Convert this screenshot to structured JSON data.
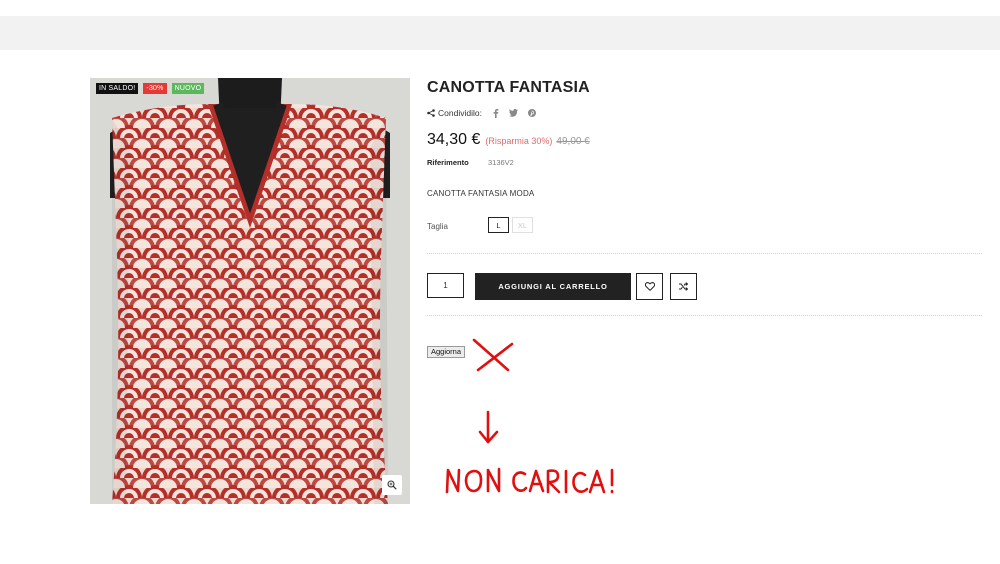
{
  "product": {
    "title": "CANOTTA FANTASIA",
    "share_label": "Condividilo:",
    "price": "34,30 €",
    "savings": "(Risparmia 30%)",
    "old_price": "49,00 €",
    "reference_label": "Riferimento",
    "reference_value": "3136V2",
    "short_description": "CANOTTA FANTASIA MODA",
    "size_label": "Taglia",
    "sizes": [
      "L",
      "XL"
    ],
    "selected_size": "L",
    "quantity": "1",
    "add_to_cart_label": "AGGIUNGI AL CARRELLO"
  },
  "badges": {
    "sale": "IN SALDO!",
    "discount": "-30%",
    "new": "NUOVO"
  },
  "update_button": "Aggiorna",
  "annotation": {
    "text": "NON CARICA!",
    "color": "#e01010"
  },
  "colors": {
    "accent_dark": "#222222",
    "savings": "#e06b6b",
    "badge_sale": "#111111",
    "badge_discount": "#e53935",
    "badge_new": "#5cb85c"
  },
  "icons": [
    "share-icon",
    "facebook-icon",
    "twitter-icon",
    "pinterest-icon",
    "heart-icon",
    "shuffle-icon",
    "zoom-icon"
  ]
}
